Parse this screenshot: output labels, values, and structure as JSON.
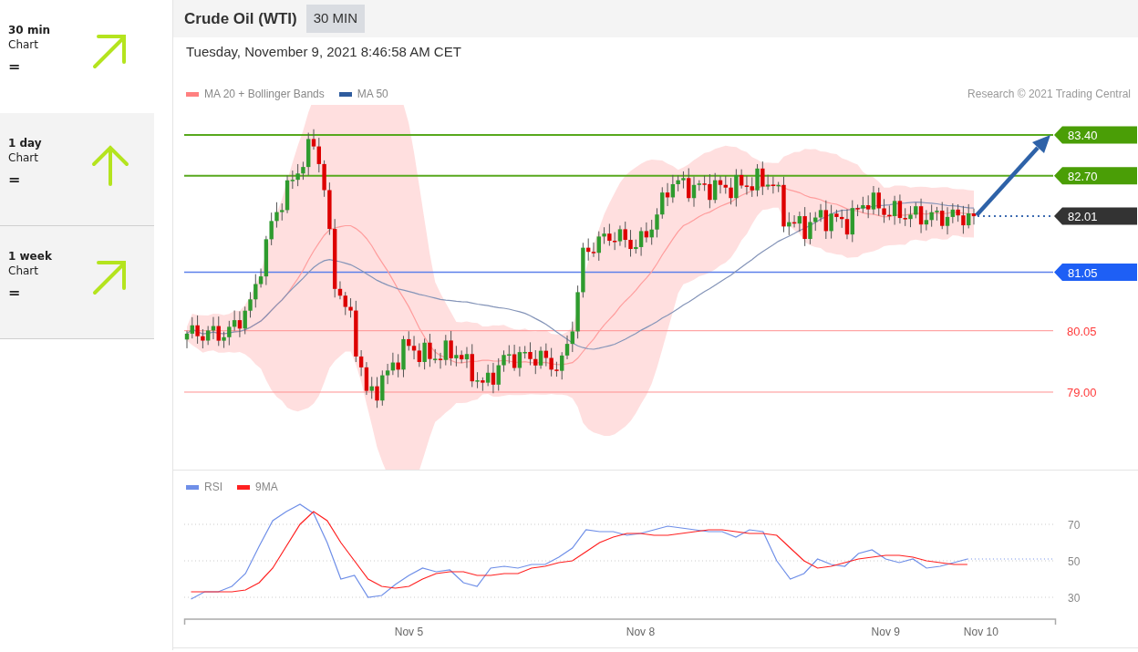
{
  "sidebar": {
    "items": [
      {
        "title": "30 min",
        "subtitle": "Chart",
        "sign": "=",
        "kind": "up-right",
        "selected": true
      },
      {
        "title": "1 day",
        "subtitle": "Chart",
        "sign": "=",
        "kind": "up",
        "selected": false
      },
      {
        "title": "1 week",
        "subtitle": "Chart",
        "sign": "=",
        "kind": "up-right",
        "selected": false
      }
    ]
  },
  "header": {
    "instrument": "Crude Oil (WTI)",
    "timeframe": "30 MIN"
  },
  "timestamp": "Tuesday, November 9, 2021 8:46:58 AM CET",
  "price_chart": {
    "legend": [
      {
        "label": "MA 20 + Bollinger Bands",
        "color": "#ff8080"
      },
      {
        "label": "MA 50",
        "color": "#2f5c9e"
      }
    ],
    "copyright": "Research © 2021 Trading Central",
    "levels": [
      {
        "label": "83.40",
        "kind": "resistance"
      },
      {
        "label": "82.70",
        "kind": "resistance"
      },
      {
        "label": "82.01",
        "kind": "last"
      },
      {
        "label": "81.05",
        "kind": "pivot"
      },
      {
        "label": "80.05",
        "kind": "support"
      },
      {
        "label": "79.00",
        "kind": "support"
      }
    ]
  },
  "rsi_chart": {
    "chart_data": {
      "type": "line",
      "categories": [
        null,
        null,
        null,
        null,
        null,
        null,
        null,
        null,
        null,
        null,
        null,
        null,
        null,
        null,
        null,
        null,
        "Nov 5",
        null,
        null,
        null,
        null,
        null,
        null,
        null,
        null,
        null,
        null,
        null,
        null,
        null,
        null,
        null,
        null,
        "Nov 8",
        null,
        null,
        null,
        null,
        null,
        null,
        null,
        null,
        null,
        null,
        null,
        null,
        null,
        null,
        null,
        null,
        null,
        "Nov 9",
        null,
        null,
        null,
        null,
        null,
        null,
        "Nov 10",
        null,
        null,
        null,
        null,
        null
      ],
      "series": [
        {
          "name": "RSI",
          "color": "#6f8fe8",
          "values": [
            29,
            33,
            33,
            36,
            43,
            58,
            72,
            77,
            81,
            76,
            60,
            40,
            42,
            30,
            31,
            37,
            42,
            46,
            44,
            45,
            38,
            36,
            46,
            47,
            46,
            48,
            48,
            52,
            57,
            67,
            66,
            66,
            64,
            65,
            67,
            69,
            68,
            67,
            66,
            66,
            63,
            67,
            66,
            50,
            40,
            43,
            51,
            48,
            47,
            54,
            56,
            51,
            49,
            51,
            46,
            47,
            49,
            51,
            null,
            null,
            null,
            null,
            null,
            null
          ]
        },
        {
          "name": "9MA",
          "color": "#ff2020",
          "values": [
            33,
            33,
            33,
            33,
            34,
            38,
            46,
            58,
            70,
            77,
            72,
            60,
            50,
            40,
            36,
            35,
            36,
            40,
            43,
            44,
            44,
            42,
            42,
            43,
            43,
            46,
            47,
            49,
            50,
            55,
            60,
            63,
            65,
            65,
            64,
            64,
            65,
            66,
            67,
            67,
            66,
            65,
            65,
            64,
            57,
            50,
            46,
            47,
            49,
            51,
            52,
            53,
            53,
            52,
            50,
            49,
            48,
            48,
            null,
            null,
            null,
            null,
            null,
            null
          ]
        }
      ],
      "ylim": [
        2,
        100
      ],
      "yticks": [
        30,
        50,
        70
      ],
      "grid": true
    }
  }
}
